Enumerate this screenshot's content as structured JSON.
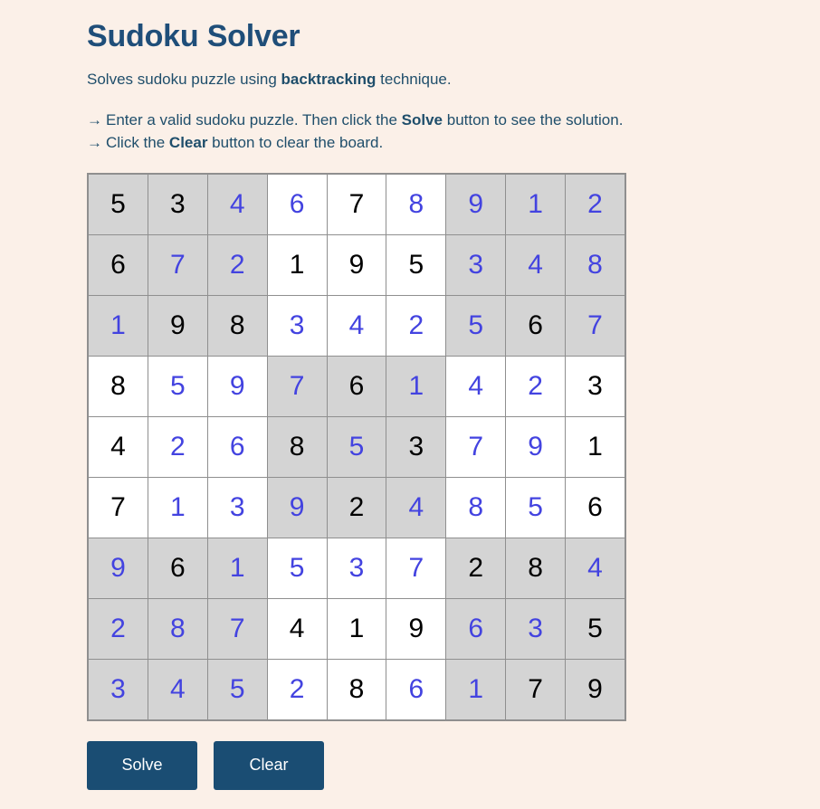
{
  "header": {
    "title": "Sudoku Solver",
    "subtitle_prefix": "Solves sudoku puzzle using ",
    "subtitle_bold": "backtracking",
    "subtitle_suffix": " technique."
  },
  "instructions": {
    "arrow": "→",
    "line1_prefix": "Enter a valid sudoku puzzle. Then click the ",
    "line1_bold": "Solve",
    "line1_suffix": " button to see the solution.",
    "line2_prefix": "Click the ",
    "line2_bold": "Clear",
    "line2_suffix": " button to clear the board."
  },
  "board": {
    "rows": [
      [
        {
          "value": "5",
          "solved": false,
          "shaded": true
        },
        {
          "value": "3",
          "solved": false,
          "shaded": true
        },
        {
          "value": "4",
          "solved": true,
          "shaded": true
        },
        {
          "value": "6",
          "solved": true,
          "shaded": false
        },
        {
          "value": "7",
          "solved": false,
          "shaded": false
        },
        {
          "value": "8",
          "solved": true,
          "shaded": false
        },
        {
          "value": "9",
          "solved": true,
          "shaded": true
        },
        {
          "value": "1",
          "solved": true,
          "shaded": true
        },
        {
          "value": "2",
          "solved": true,
          "shaded": true
        }
      ],
      [
        {
          "value": "6",
          "solved": false,
          "shaded": true
        },
        {
          "value": "7",
          "solved": true,
          "shaded": true
        },
        {
          "value": "2",
          "solved": true,
          "shaded": true
        },
        {
          "value": "1",
          "solved": false,
          "shaded": false
        },
        {
          "value": "9",
          "solved": false,
          "shaded": false
        },
        {
          "value": "5",
          "solved": false,
          "shaded": false
        },
        {
          "value": "3",
          "solved": true,
          "shaded": true
        },
        {
          "value": "4",
          "solved": true,
          "shaded": true
        },
        {
          "value": "8",
          "solved": true,
          "shaded": true
        }
      ],
      [
        {
          "value": "1",
          "solved": true,
          "shaded": true
        },
        {
          "value": "9",
          "solved": false,
          "shaded": true
        },
        {
          "value": "8",
          "solved": false,
          "shaded": true
        },
        {
          "value": "3",
          "solved": true,
          "shaded": false
        },
        {
          "value": "4",
          "solved": true,
          "shaded": false
        },
        {
          "value": "2",
          "solved": true,
          "shaded": false
        },
        {
          "value": "5",
          "solved": true,
          "shaded": true
        },
        {
          "value": "6",
          "solved": false,
          "shaded": true
        },
        {
          "value": "7",
          "solved": true,
          "shaded": true
        }
      ],
      [
        {
          "value": "8",
          "solved": false,
          "shaded": false
        },
        {
          "value": "5",
          "solved": true,
          "shaded": false
        },
        {
          "value": "9",
          "solved": true,
          "shaded": false
        },
        {
          "value": "7",
          "solved": true,
          "shaded": true
        },
        {
          "value": "6",
          "solved": false,
          "shaded": true
        },
        {
          "value": "1",
          "solved": true,
          "shaded": true
        },
        {
          "value": "4",
          "solved": true,
          "shaded": false
        },
        {
          "value": "2",
          "solved": true,
          "shaded": false
        },
        {
          "value": "3",
          "solved": false,
          "shaded": false
        }
      ],
      [
        {
          "value": "4",
          "solved": false,
          "shaded": false
        },
        {
          "value": "2",
          "solved": true,
          "shaded": false
        },
        {
          "value": "6",
          "solved": true,
          "shaded": false
        },
        {
          "value": "8",
          "solved": false,
          "shaded": true
        },
        {
          "value": "5",
          "solved": true,
          "shaded": true
        },
        {
          "value": "3",
          "solved": false,
          "shaded": true
        },
        {
          "value": "7",
          "solved": true,
          "shaded": false
        },
        {
          "value": "9",
          "solved": true,
          "shaded": false
        },
        {
          "value": "1",
          "solved": false,
          "shaded": false
        }
      ],
      [
        {
          "value": "7",
          "solved": false,
          "shaded": false
        },
        {
          "value": "1",
          "solved": true,
          "shaded": false
        },
        {
          "value": "3",
          "solved": true,
          "shaded": false
        },
        {
          "value": "9",
          "solved": true,
          "shaded": true
        },
        {
          "value": "2",
          "solved": false,
          "shaded": true
        },
        {
          "value": "4",
          "solved": true,
          "shaded": true
        },
        {
          "value": "8",
          "solved": true,
          "shaded": false
        },
        {
          "value": "5",
          "solved": true,
          "shaded": false
        },
        {
          "value": "6",
          "solved": false,
          "shaded": false
        }
      ],
      [
        {
          "value": "9",
          "solved": true,
          "shaded": true
        },
        {
          "value": "6",
          "solved": false,
          "shaded": true
        },
        {
          "value": "1",
          "solved": true,
          "shaded": true
        },
        {
          "value": "5",
          "solved": true,
          "shaded": false
        },
        {
          "value": "3",
          "solved": true,
          "shaded": false
        },
        {
          "value": "7",
          "solved": true,
          "shaded": false
        },
        {
          "value": "2",
          "solved": false,
          "shaded": true
        },
        {
          "value": "8",
          "solved": false,
          "shaded": true
        },
        {
          "value": "4",
          "solved": true,
          "shaded": true
        }
      ],
      [
        {
          "value": "2",
          "solved": true,
          "shaded": true
        },
        {
          "value": "8",
          "solved": true,
          "shaded": true
        },
        {
          "value": "7",
          "solved": true,
          "shaded": true
        },
        {
          "value": "4",
          "solved": false,
          "shaded": false
        },
        {
          "value": "1",
          "solved": false,
          "shaded": false
        },
        {
          "value": "9",
          "solved": false,
          "shaded": false
        },
        {
          "value": "6",
          "solved": true,
          "shaded": true
        },
        {
          "value": "3",
          "solved": true,
          "shaded": true
        },
        {
          "value": "5",
          "solved": false,
          "shaded": true
        }
      ],
      [
        {
          "value": "3",
          "solved": true,
          "shaded": true
        },
        {
          "value": "4",
          "solved": true,
          "shaded": true
        },
        {
          "value": "5",
          "solved": true,
          "shaded": true
        },
        {
          "value": "2",
          "solved": true,
          "shaded": false
        },
        {
          "value": "8",
          "solved": false,
          "shaded": false
        },
        {
          "value": "6",
          "solved": true,
          "shaded": false
        },
        {
          "value": "1",
          "solved": true,
          "shaded": true
        },
        {
          "value": "7",
          "solved": false,
          "shaded": true
        },
        {
          "value": "9",
          "solved": false,
          "shaded": true
        }
      ]
    ]
  },
  "buttons": {
    "solve_label": "Solve",
    "clear_label": "Clear"
  },
  "colors": {
    "page_background": "#fbf0e8",
    "title": "#1f4e79",
    "text": "#1f4e6b",
    "given_digit": "#000000",
    "solved_digit": "#4343e0",
    "cell_shaded": "#d4d4d4",
    "cell_plain": "#ffffff",
    "grid_line": "#8f8f8f",
    "button_background": "#1a4d73",
    "button_text": "#ffffff"
  }
}
